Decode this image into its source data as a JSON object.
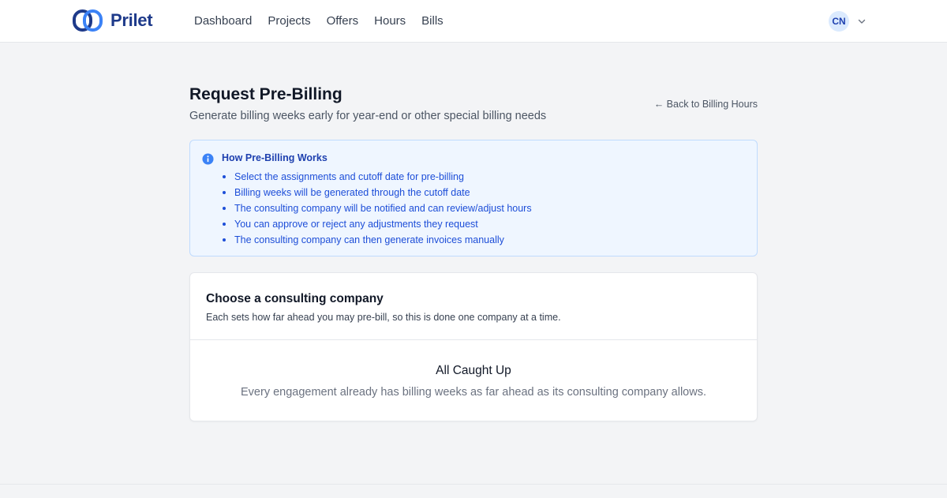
{
  "brand": {
    "name": "Prilet",
    "logo_icon": "linked-rings-logo",
    "color": "#1e3a8a"
  },
  "nav": {
    "items": [
      {
        "label": "Dashboard"
      },
      {
        "label": "Projects"
      },
      {
        "label": "Offers"
      },
      {
        "label": "Hours"
      },
      {
        "label": "Bills"
      }
    ]
  },
  "user": {
    "initials": "CN",
    "menu_icon": "chevron-down-icon"
  },
  "header": {
    "title": "Request Pre-Billing",
    "subtitle": "Generate billing weeks early for year-end or other special billing needs",
    "back_link": "← Back to Billing Hours"
  },
  "info_box": {
    "icon": "info-icon",
    "title": "How Pre-Billing Works",
    "items": [
      "Select the assignments and cutoff date for pre-billing",
      "Billing weeks will be generated through the cutoff date",
      "The consulting company will be notified and can review/adjust hours",
      "You can approve or reject any adjustments they request",
      "The consulting company can then generate invoices manually"
    ],
    "accent_color": "#1d4ed8"
  },
  "company_card": {
    "title": "Choose a consulting company",
    "description": "Each sets how far ahead you may pre-bill, so this is done one company at a time.",
    "empty_title": "All Caught Up",
    "empty_description": "Every engagement already has billing weeks as far ahead as its consulting company allows."
  }
}
